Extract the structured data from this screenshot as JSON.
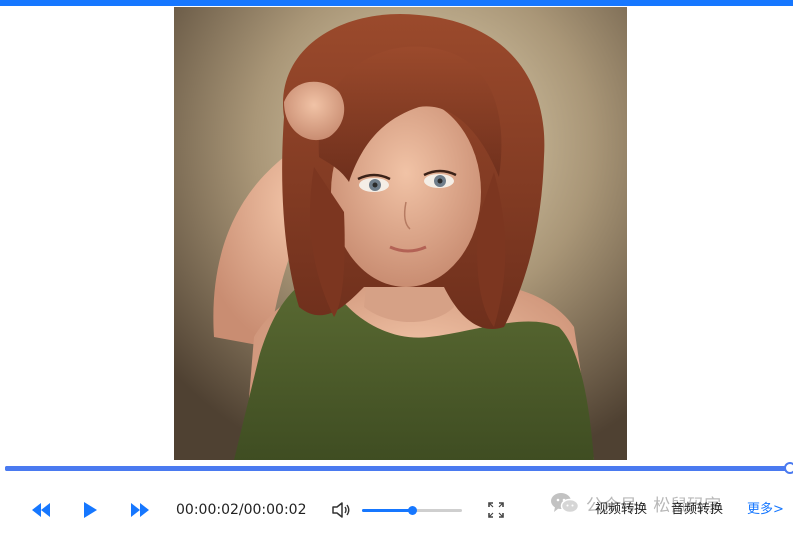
{
  "player": {
    "accent_color": "#1677ff",
    "progress_color": "#4a7af0",
    "progress_fraction": 1.0,
    "volume_fraction": 0.5,
    "time_display": "00:00:02/00:00:02",
    "controls": {
      "rewind_icon": "rewind-icon",
      "play_icon": "play-icon",
      "forward_icon": "fast-forward-icon",
      "volume_icon": "speaker-icon",
      "fullscreen_icon": "fullscreen-icon"
    }
  },
  "links": {
    "video_convert": "视频转换",
    "audio_convert": "音频转换",
    "more": "更多>"
  },
  "watermark": {
    "icon": "wechat-icon",
    "text": "公众号 · 松鼠码字"
  }
}
